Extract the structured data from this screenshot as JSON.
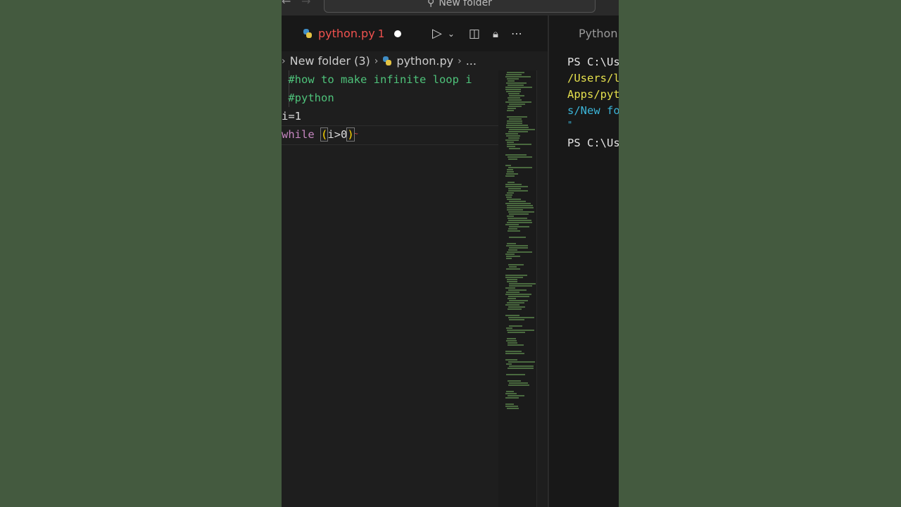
{
  "window": {
    "command_center": "New folder",
    "back_icon": "arrow-left-icon",
    "forward_icon": "arrow-right-icon"
  },
  "editor": {
    "tab": {
      "label": "python.py",
      "problem_count": "1",
      "modified": true
    },
    "breadcrumb": {
      "folder": "New folder (3)",
      "file": "python.py",
      "more": "..."
    },
    "code_lines": [
      " #how to make infinite loop i",
      " #python",
      "i=1",
      "while (i>0)"
    ],
    "code_parts": {
      "line3_var": "i",
      "line3_op": "=1",
      "line4_kw": "while",
      "line4_open": "(",
      "line4_inner": "i>0",
      "line4_close": ")"
    }
  },
  "terminal": {
    "tab_label": "Python",
    "lines": [
      "PS C:\\Us",
      "/Users/l",
      "Apps/pyt",
      "s/New fo",
      "\"",
      "PS C:\\Us"
    ]
  },
  "colors": {
    "background": "#445a3f",
    "editor_bg": "#1e1e1e",
    "comment": "#4ec27a",
    "keyword": "#c586c0",
    "error_tab": "#f0524f"
  }
}
